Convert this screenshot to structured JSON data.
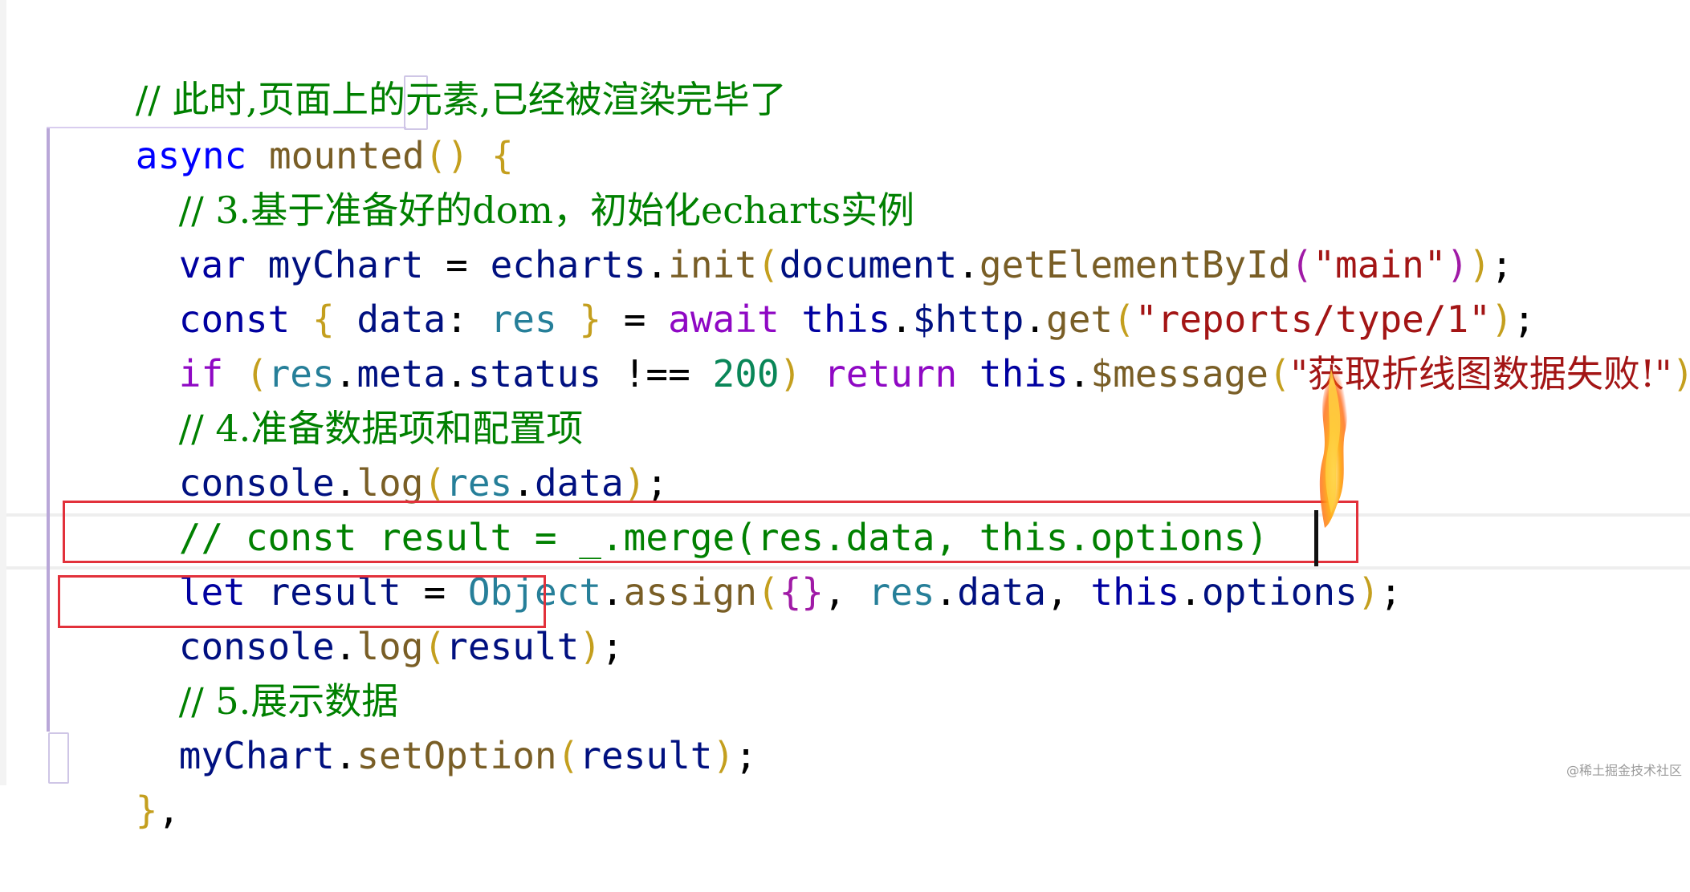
{
  "code": {
    "comment_top": "// 此时,页面上的元素,已经被渲染完毕了",
    "kw_async": "async",
    "fn_mounted": "mounted",
    "paren_open": "(",
    "paren_close": ")",
    "brace_open": "{",
    "comment_3": "// 3.基于准备好的dom，初始化echarts实例",
    "kw_var": "var",
    "var_mychart": "myChart",
    "op_eq": "=",
    "obj_echarts": "echarts",
    "dot": ".",
    "fn_init": "init",
    "obj_document": "document",
    "fn_get_by_id": "getElementById",
    "str_main": "\"main\"",
    "semi": ";",
    "kw_const": "const",
    "prop_data": "data",
    "colon": ":",
    "var_res": "res",
    "kw_await": "await",
    "kw_this": "this",
    "prop_http": "$http",
    "fn_get": "get",
    "str_reports": "\"reports/type/1\"",
    "kw_if": "if",
    "prop_meta": "meta",
    "prop_status": "status",
    "op_neq": "!==",
    "num_200": "200",
    "kw_return": "return",
    "prop_message": "$message",
    "str_fail": "\"获取折线图数据失败!\"",
    "comment_4": "// 4.准备数据项和配置项",
    "obj_console": "console",
    "fn_log": "log",
    "comment_merge": "// const result = _.merge(res.data, this.options)",
    "kw_let": "let",
    "var_result": "result",
    "cls_object": "Object",
    "fn_assign": "assign",
    "empty_obj": "{}",
    "comma": ",",
    "prop_options": "options",
    "comment_5": "// 5.展示数据",
    "fn_set_option": "setOption",
    "brace_close": "}",
    "trailing_comma": ","
  },
  "watermark": "@稀土掘金技术社区",
  "colors": {
    "highlight_box": "#e2313b",
    "keyword": "#0000ff",
    "comment": "#008000",
    "string": "#a31515"
  }
}
